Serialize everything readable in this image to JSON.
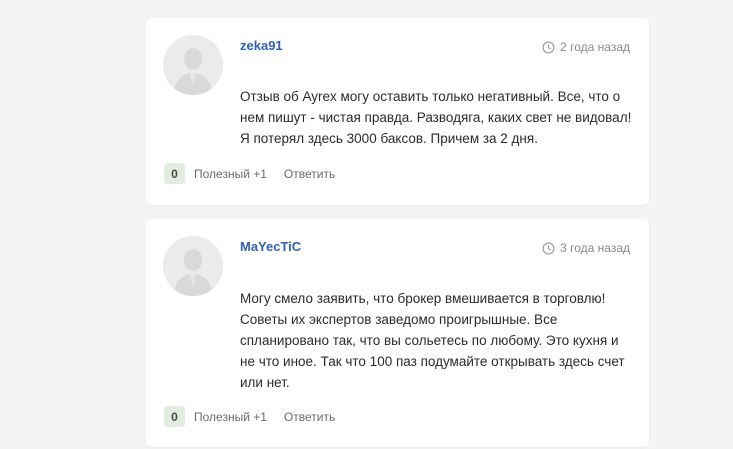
{
  "comments": [
    {
      "author": "zeka91",
      "date": "2 года назад",
      "lines": [
        "Отзыв об Ayrex могу оставить только негативный. Все, что о",
        "нем пишут - чистая правда. Разводяга, каких свет не видовал!",
        "Я потерял здесь 3000 баксов. Причем за 2 дня."
      ],
      "votes": "0",
      "helpful_label": "Полезный +1",
      "reply_label": "Ответить"
    },
    {
      "author": "MaYecTiC",
      "date": "3 года назад",
      "lines": [
        "Могу смело заявить, что брокер вмешивается в торговлю!",
        "Советы их экспертов заведомо проигрышные. Все",
        "спланировано так, что вы сольетесь по любому. Это кухня и",
        "не что иное. Так что 100 паз подумайте открывать здесь счет",
        "или нет."
      ],
      "votes": "0",
      "helpful_label": "Полезный +1",
      "reply_label": "Ответить"
    }
  ],
  "icons": {
    "avatar": "user-silhouette-icon",
    "date": "clock-icon"
  }
}
